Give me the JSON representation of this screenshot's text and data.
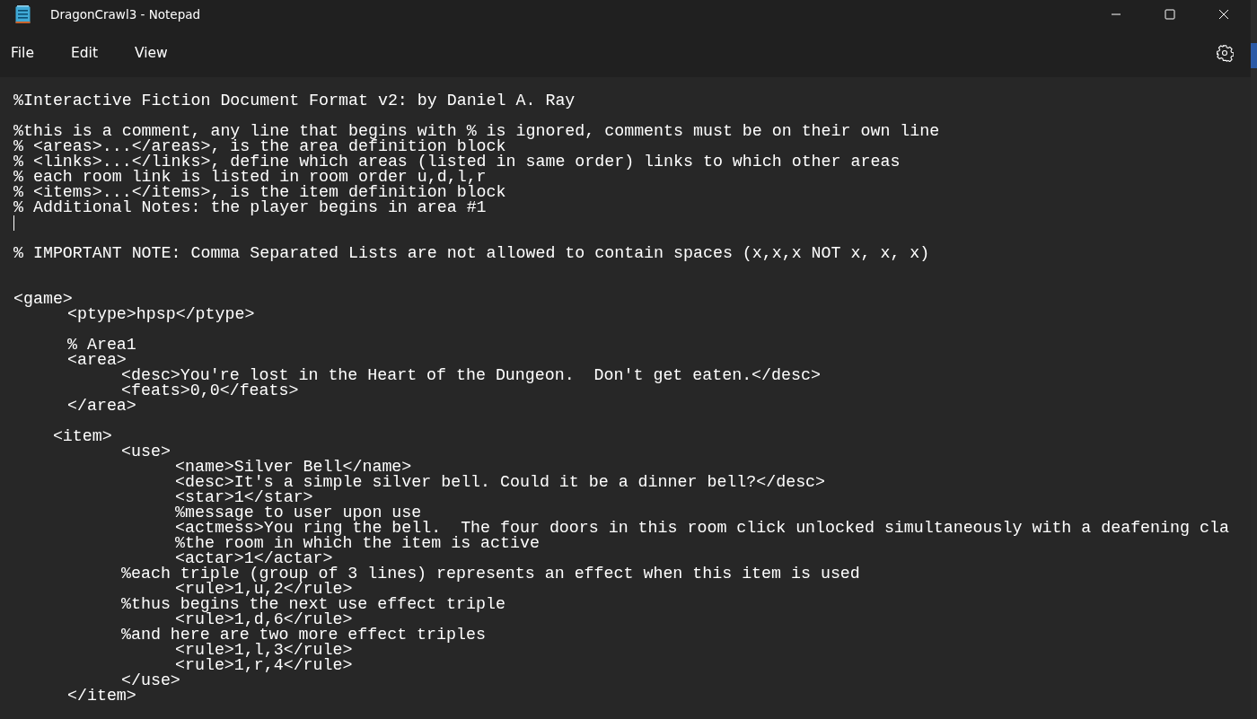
{
  "window": {
    "title": "DragonCrawl3 - Notepad"
  },
  "menu": [
    {
      "label": "File"
    },
    {
      "label": "Edit"
    },
    {
      "label": "View"
    }
  ],
  "lines": [
    {
      "kind": "text",
      "text": "%Interactive Fiction Document Format v2: by Daniel A. Ray"
    },
    {
      "kind": "blank"
    },
    {
      "kind": "text",
      "text": "%this is a comment, any line that begins with % is ignored, comments must be on their own line"
    },
    {
      "kind": "text",
      "text": "% <areas>...</areas>, is the area definition block"
    },
    {
      "kind": "text",
      "text": "% <links>...</links>, define which areas (listed in same order) links to which other areas"
    },
    {
      "kind": "text",
      "text": "% each room link is listed in room order u,d,l,r"
    },
    {
      "kind": "text",
      "text": "% <items>...</items>, is the item definition block"
    },
    {
      "kind": "text",
      "text": "% Additional Notes: the player begins in area #1"
    },
    {
      "kind": "cursor"
    },
    {
      "kind": "blank"
    },
    {
      "kind": "text",
      "text": "% IMPORTANT NOTE: Comma Separated Lists are not allowed to contain spaces (x,x,x NOT x, x, x)"
    },
    {
      "kind": "blank"
    },
    {
      "kind": "blank"
    },
    {
      "kind": "text",
      "text": "<game>"
    },
    {
      "kind": "text",
      "text": "\t<ptype>hpsp</ptype>"
    },
    {
      "kind": "blank"
    },
    {
      "kind": "text",
      "text": "\t% Area1"
    },
    {
      "kind": "text",
      "text": "\t<area>"
    },
    {
      "kind": "text",
      "text": "\t\t<desc>You're lost in the Heart of the Dungeon.  Don't get eaten.</desc>"
    },
    {
      "kind": "text",
      "text": "\t\t<feats>0,0</feats>"
    },
    {
      "kind": "text",
      "text": "\t</area>"
    },
    {
      "kind": "blank"
    },
    {
      "kind": "text",
      "text": "    <item>"
    },
    {
      "kind": "text",
      "text": "\t\t<use>"
    },
    {
      "kind": "text",
      "text": "\t\t\t<name>Silver Bell</name>"
    },
    {
      "kind": "text",
      "text": "\t\t\t<desc>It's a simple silver bell. Could it be a dinner bell?</desc>"
    },
    {
      "kind": "text",
      "text": "\t\t\t<star>1</star>"
    },
    {
      "kind": "text",
      "text": "\t\t\t%message to user upon use"
    },
    {
      "kind": "text",
      "text": "\t\t\t<actmess>You ring the bell.  The four doors in this room click unlocked simultaneously with a deafening cla"
    },
    {
      "kind": "text",
      "text": "\t\t\t%the room in which the item is active"
    },
    {
      "kind": "text",
      "text": "\t\t\t<actar>1</actar>"
    },
    {
      "kind": "text",
      "text": "\t\t%each triple (group of 3 lines) represents an effect when this item is used"
    },
    {
      "kind": "text",
      "text": "\t\t\t<rule>1,u,2</rule>"
    },
    {
      "kind": "text",
      "text": "\t\t%thus begins the next use effect triple"
    },
    {
      "kind": "text",
      "text": "\t\t\t<rule>1,d,6</rule>"
    },
    {
      "kind": "text",
      "text": "\t\t%and here are two more effect triples"
    },
    {
      "kind": "text",
      "text": "\t\t\t<rule>1,l,3</rule>"
    },
    {
      "kind": "text",
      "text": "\t\t\t<rule>1,r,4</rule>"
    },
    {
      "kind": "text",
      "text": "\t\t</use>"
    },
    {
      "kind": "text",
      "text": "\t</item>"
    }
  ]
}
